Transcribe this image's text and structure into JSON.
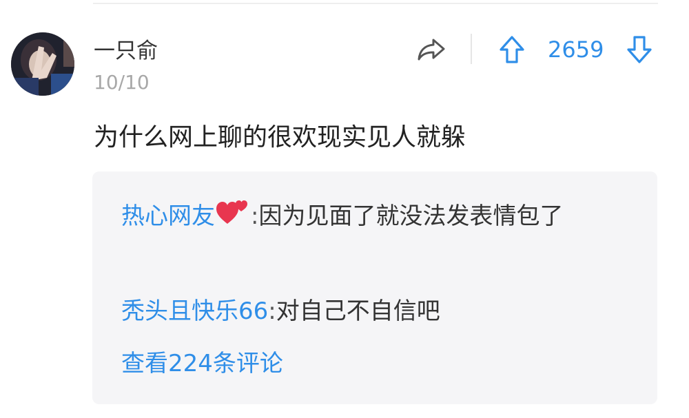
{
  "comment": {
    "author": "一只俞",
    "date": "10/10",
    "text": "为什么网上聊的很欢现实见人就躲",
    "vote_count": "2659"
  },
  "icons": {
    "share": "share-arrow-icon",
    "upvote": "arrow-up-icon",
    "downvote": "arrow-down-icon",
    "heart": "two-hearts-icon"
  },
  "colors": {
    "accent": "#2f8ee8",
    "reply_background": "#f5f5f7",
    "muted_text": "#a8a8a8",
    "heart": "#e8364f"
  },
  "replies": [
    {
      "author": "热心网友",
      "separator": ":",
      "text": "因为见面了就没法发表情包了"
    },
    {
      "author": "秃头且快乐66",
      "separator": ":",
      "text": "对自己不自信吧"
    }
  ],
  "view_more_label": "查看224条评论"
}
